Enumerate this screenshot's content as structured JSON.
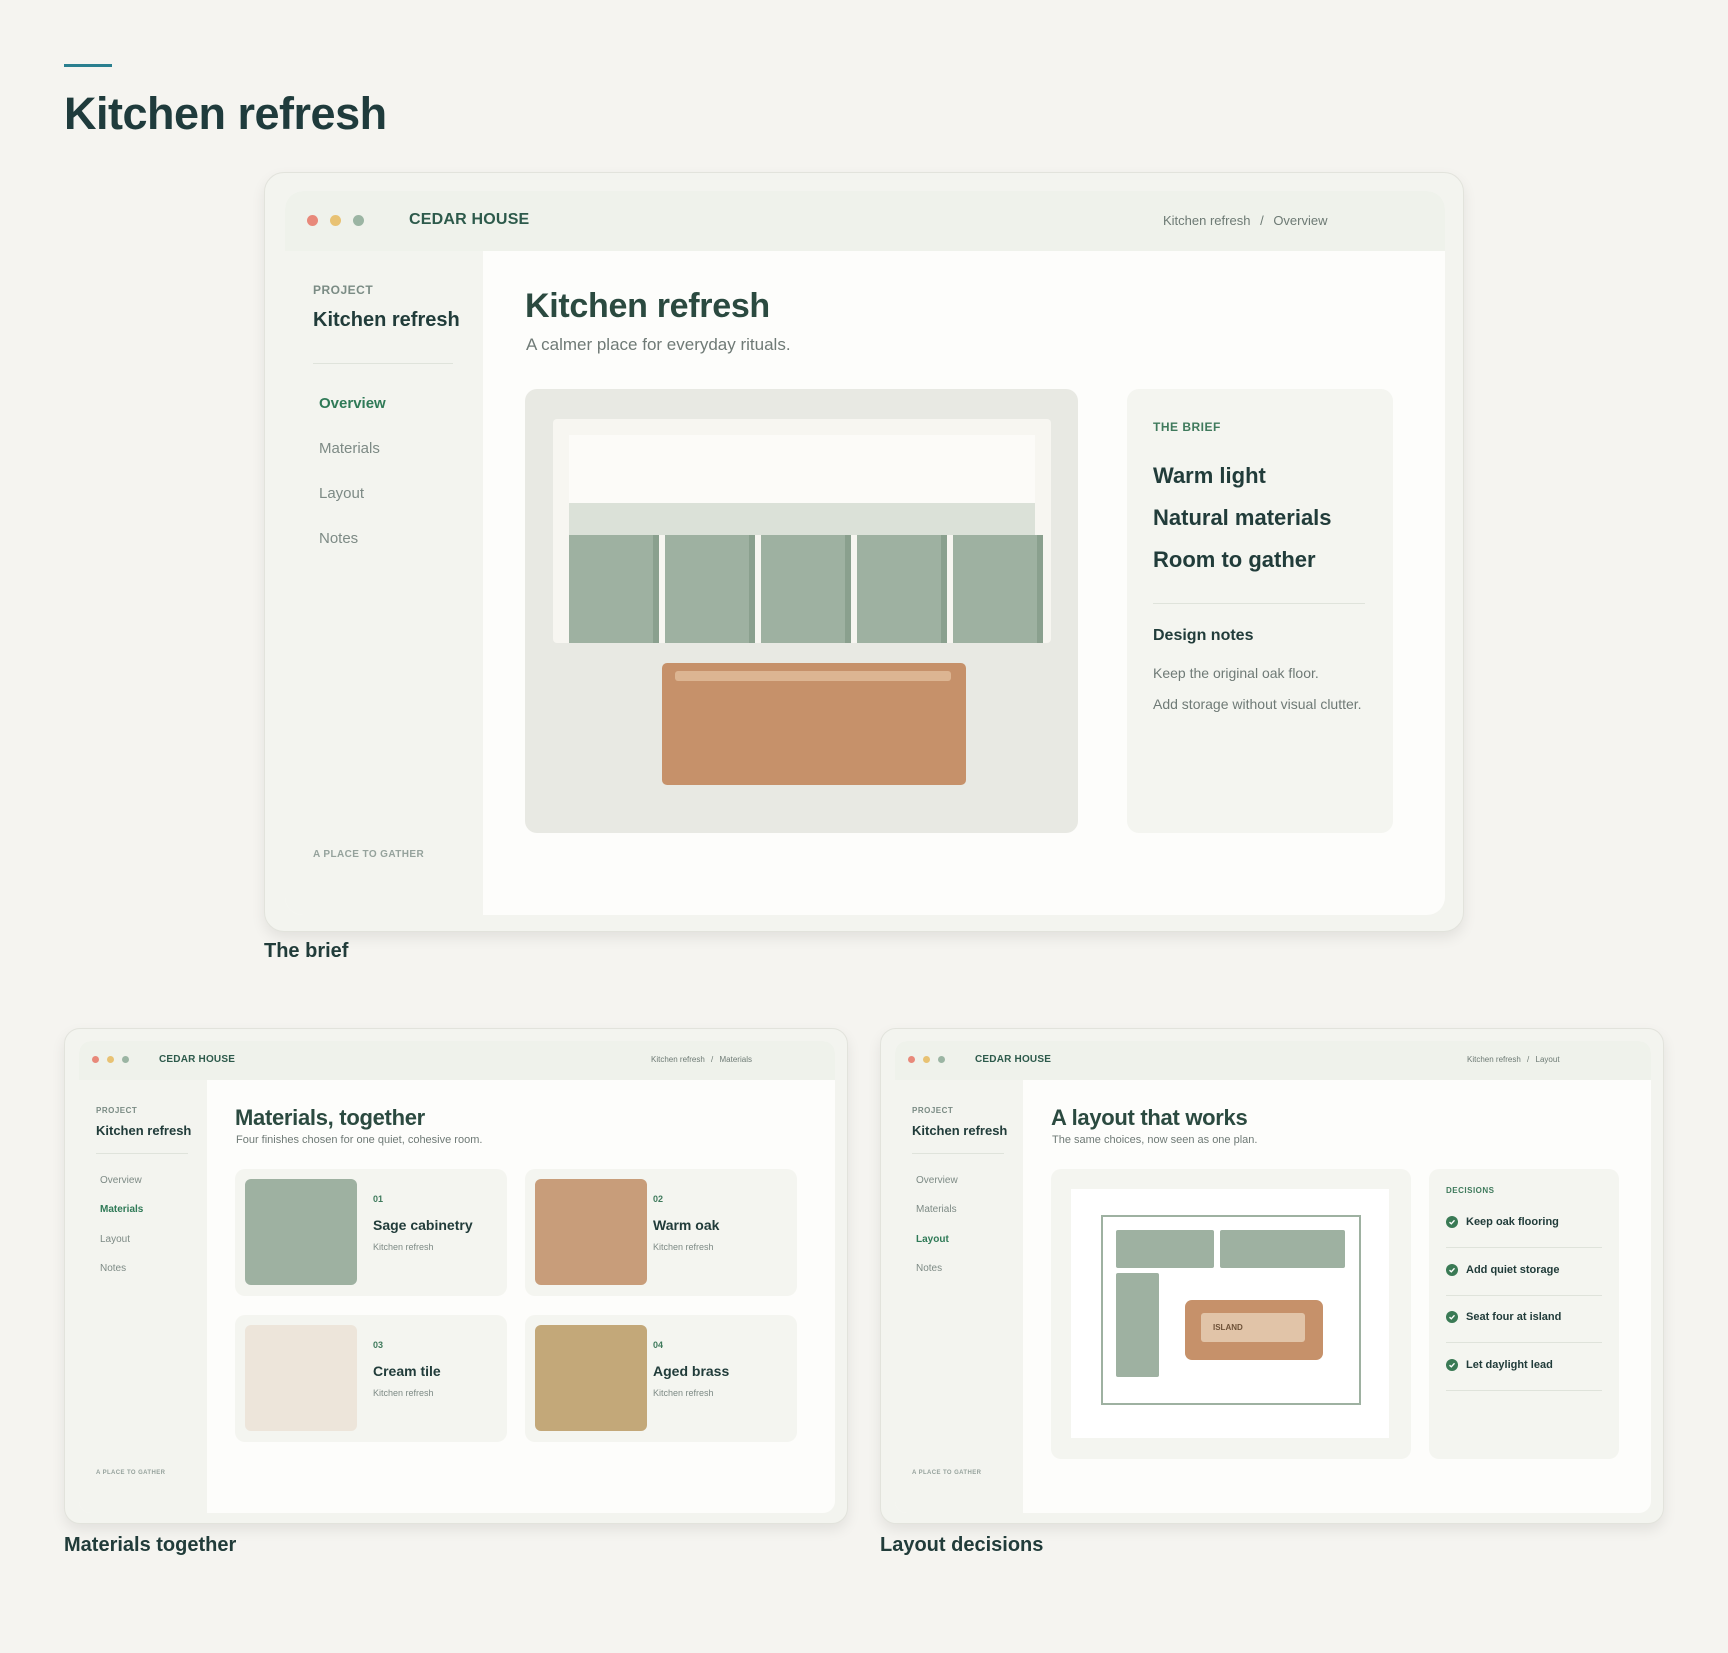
{
  "page": {
    "title": "Kitchen refresh"
  },
  "app": {
    "brand": "CEDAR HOUSE",
    "sidebar_eyebrow": "PROJECT",
    "project_name": "Kitchen refresh",
    "footer_tag": "A PLACE TO GATHER",
    "crumb_sep": "/"
  },
  "nav": [
    "Overview",
    "Materials",
    "Layout",
    "Notes"
  ],
  "window_dots": [
    "#e8897a",
    "#e8c273",
    "#9bb5a3"
  ],
  "brief_card": {
    "caption": "The brief",
    "crumb_root": "Kitchen refresh",
    "crumb_page": "Overview",
    "heading": "Kitchen refresh",
    "subheading": "A calmer place for everyday rituals.",
    "panel": {
      "eyebrow": "THE BRIEF",
      "goals": [
        "Warm light",
        "Natural materials",
        "Room to gather"
      ],
      "notes_title": "Design notes",
      "notes": [
        "Keep the original oak floor.",
        "Add storage without visual clutter."
      ]
    }
  },
  "materials_card": {
    "caption": "Materials together",
    "crumb_root": "Kitchen refresh",
    "crumb_page": "Materials",
    "heading": "Materials, together",
    "subheading": "Four finishes chosen for one quiet, cohesive room.",
    "items": [
      {
        "num": "01",
        "name": "Sage cabinetry",
        "sub": "Kitchen refresh",
        "color": "#9eb1a1"
      },
      {
        "num": "02",
        "name": "Warm oak",
        "sub": "Kitchen refresh",
        "color": "#c89d7a"
      },
      {
        "num": "03",
        "name": "Cream tile",
        "sub": "Kitchen refresh",
        "color": "#ede5da"
      },
      {
        "num": "04",
        "name": "Aged brass",
        "sub": "Kitchen refresh",
        "color": "#c3a879"
      }
    ]
  },
  "layout_card": {
    "caption": "Layout decisions",
    "crumb_root": "Kitchen refresh",
    "crumb_page": "Layout",
    "heading": "A layout that works",
    "subheading": "The same choices, now seen as one plan.",
    "island_label": "ISLAND",
    "decisions_eyebrow": "DECISIONS",
    "decisions": [
      "Keep oak flooring",
      "Add quiet storage",
      "Seat four at island",
      "Let daylight lead"
    ]
  },
  "colors": {
    "accent": "#2f7a57",
    "sage": "#9eb1a1",
    "oak": "#c6916a",
    "heading": "#1f3b3c"
  }
}
